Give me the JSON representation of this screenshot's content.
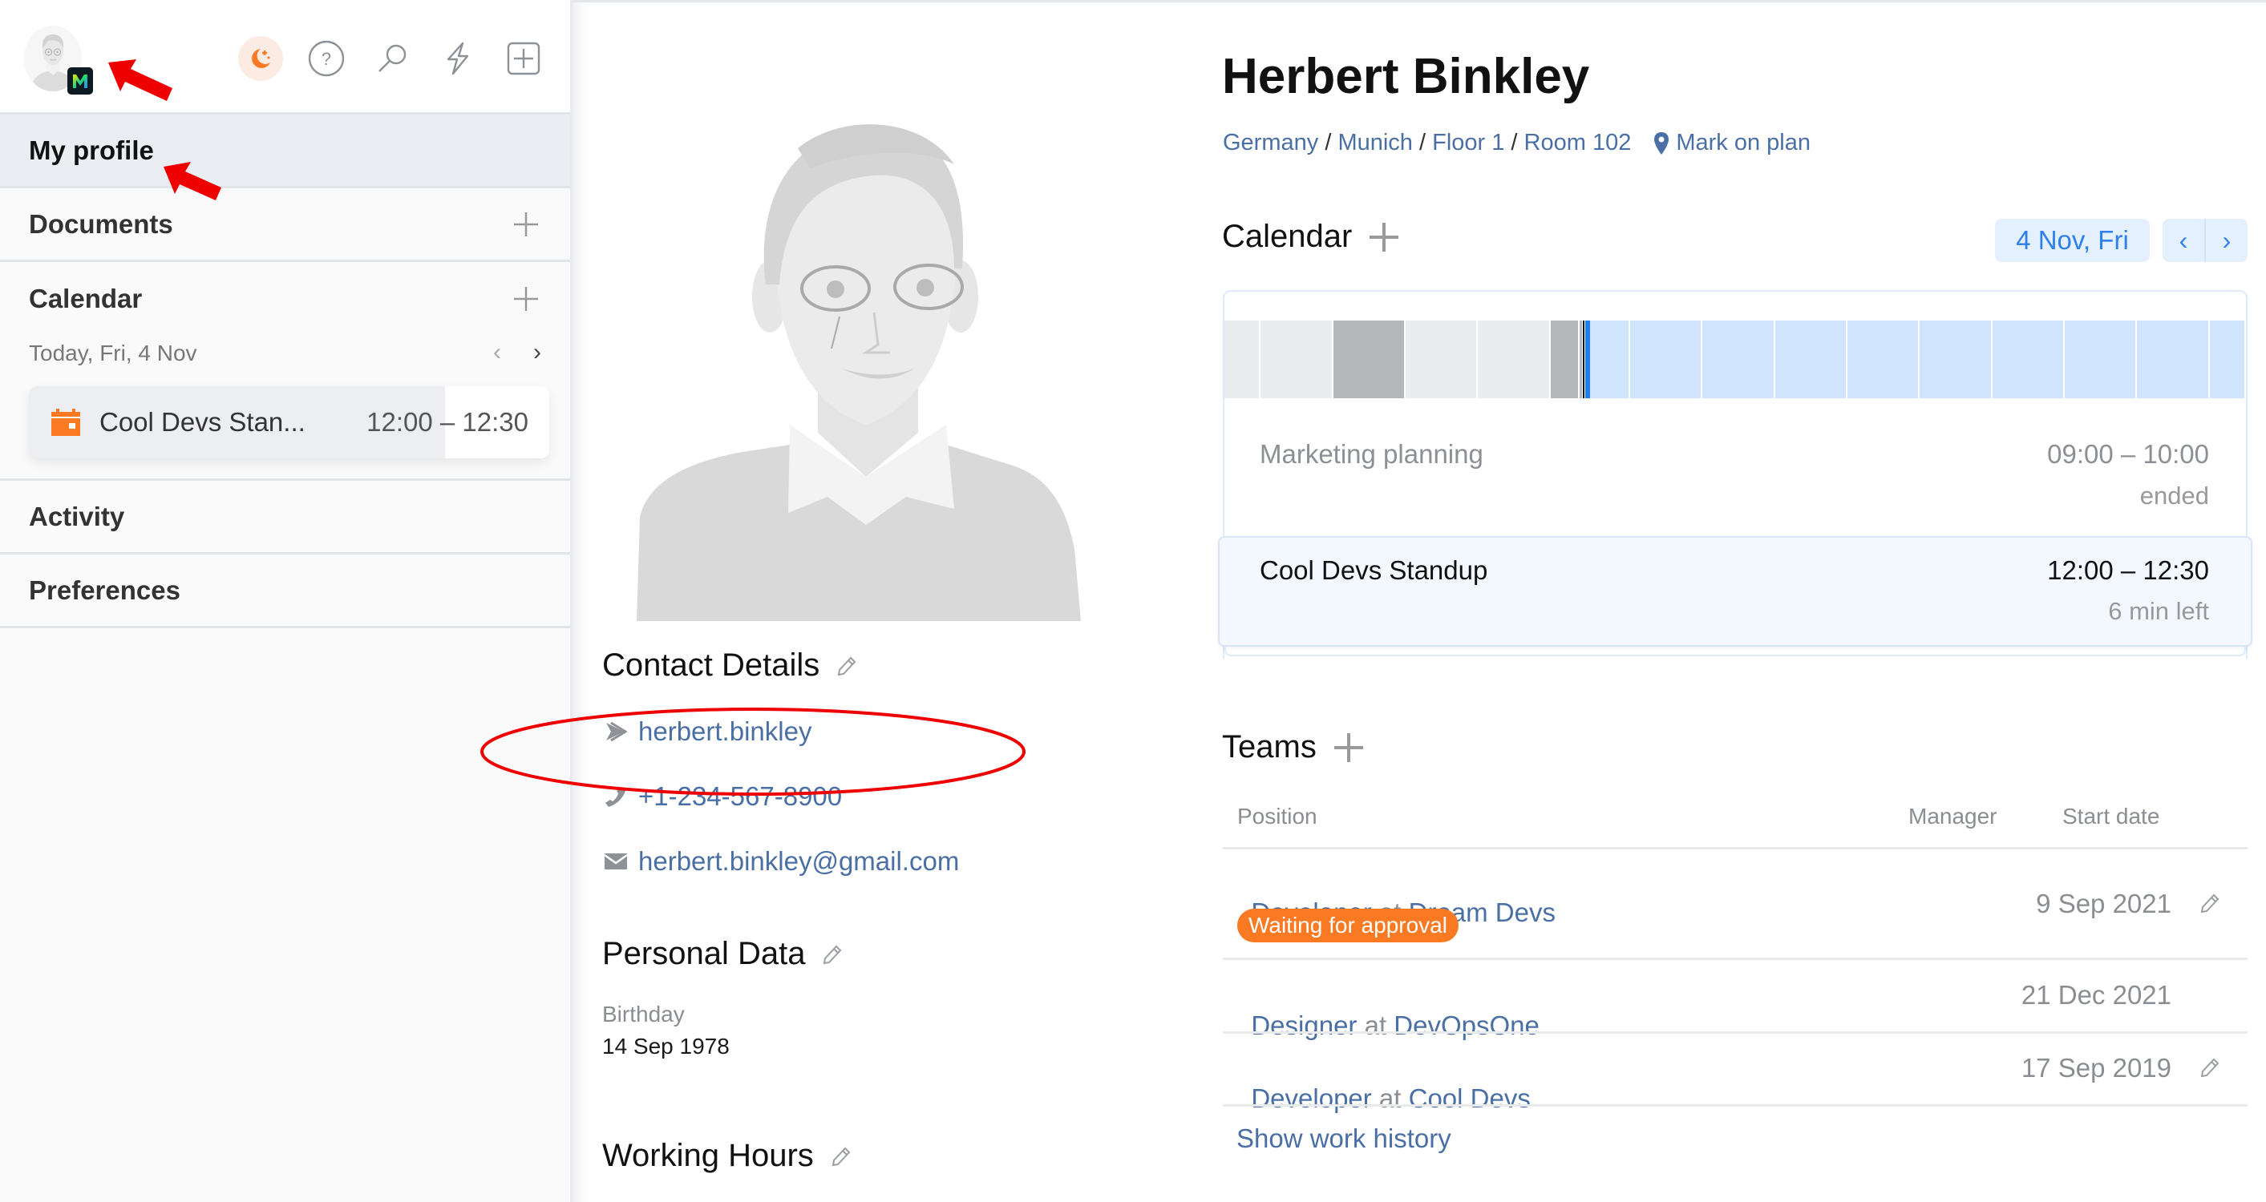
{
  "sidebar": {
    "user_avatar_alt": "User avatar",
    "badge_letter": "M",
    "toolbar_icons": [
      "theme-night-icon",
      "help-icon",
      "search-icon",
      "lightning-icon",
      "add-box-icon"
    ],
    "items": [
      {
        "label": "My profile",
        "active": true
      },
      {
        "label": "Documents",
        "has_add": true
      },
      {
        "label": "Calendar",
        "has_add": true
      },
      {
        "label": "Activity"
      },
      {
        "label": "Preferences"
      }
    ],
    "calendar": {
      "today_label": "Today, Fri, 4 Nov",
      "prev": "‹",
      "next": "›",
      "event": {
        "title": "Cool Devs Stan...",
        "time": "12:00 – 12:30",
        "progress_fraction": 0.8,
        "icon": "calendar-icon"
      }
    }
  },
  "profile": {
    "name": "Herbert Binkley",
    "location": {
      "country": "Germany",
      "city": "Munich",
      "floor": "Floor 1",
      "room": "Room 102",
      "mark_on_plan": "Mark on plan",
      "separator": " / "
    },
    "contact_details": {
      "title": "Contact Details",
      "items": [
        {
          "icon": "messenger-icon",
          "value": "herbert.binkley"
        },
        {
          "icon": "phone-icon",
          "value": "+1-234-567-8900"
        },
        {
          "icon": "email-icon",
          "value": "herbert.binkley@gmail.com"
        }
      ]
    },
    "personal_data": {
      "title": "Personal Data",
      "birthday_label": "Birthday",
      "birthday_value": "14 Sep 1978"
    },
    "working_hours": {
      "title": "Working Hours"
    }
  },
  "calendar": {
    "title": "Calendar",
    "date_button": "4 Nov, Fri",
    "prev": "‹",
    "next": "›",
    "timeline": {
      "colors": {
        "past_free": "#ebecee",
        "past_busy": "#b5b8ba",
        "future": "#d0e4fd",
        "now_marker": "#1f7cf0"
      },
      "segments": [
        {
          "state": "past_free",
          "units": 0.5
        },
        {
          "state": "past_free",
          "units": 1
        },
        {
          "state": "past_busy",
          "units": 1
        },
        {
          "state": "past_free",
          "units": 1
        },
        {
          "state": "past_free",
          "units": 1
        },
        {
          "state": "past_busy",
          "units": 0.4
        },
        {
          "state": "now",
          "units": 0.15
        },
        {
          "state": "future",
          "units": 0.55
        },
        {
          "state": "future",
          "units": 1
        },
        {
          "state": "future",
          "units": 1
        },
        {
          "state": "future",
          "units": 1
        },
        {
          "state": "future",
          "units": 1
        },
        {
          "state": "future",
          "units": 1
        },
        {
          "state": "future",
          "units": 1
        },
        {
          "state": "future",
          "units": 1
        },
        {
          "state": "future",
          "units": 1
        },
        {
          "state": "future",
          "units": 0.5
        }
      ]
    },
    "events": [
      {
        "title": "Marketing planning",
        "time": "09:00 – 10:00",
        "status": "ended",
        "state": "past"
      },
      {
        "title": "Cool Devs Standup",
        "time": "12:00 – 12:30",
        "status": "6 min left",
        "state": "current"
      }
    ]
  },
  "teams": {
    "title": "Teams",
    "columns": {
      "position": "Position",
      "manager": "Manager",
      "start_date": "Start date"
    },
    "rows": [
      {
        "role": "Developer",
        "at": " at ",
        "team": "Dream Devs",
        "start_date": "9 Sep 2021",
        "badge": "Waiting for approval",
        "editable": true
      },
      {
        "role": "Designer",
        "at": " at ",
        "team": "DevOpsOne",
        "start_date": "21 Dec 2021",
        "editable": false
      },
      {
        "role": "Developer",
        "at": " at ",
        "team": "Cool Devs",
        "start_date": "17 Sep 2019",
        "editable": true
      }
    ],
    "show_history": "Show work history"
  },
  "colors": {
    "accent_orange": "#f97a22",
    "link_blue": "#4a6fa5",
    "button_blue": "#2f80ed",
    "annotation_red": "#ee0000"
  }
}
